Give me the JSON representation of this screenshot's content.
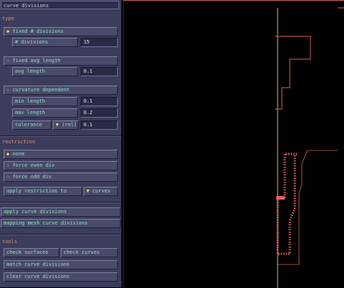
{
  "panel": {
    "title": "curve divisions",
    "type_label": "type",
    "fixed_divisions": "fixed # divisions",
    "num_divisions_label": "# divisions",
    "num_divisions_value": "15",
    "fixed_avg_length": "fixed avg length",
    "avg_length_label": "avg length",
    "avg_length_value": "0.1",
    "curvature_dependent": "curvature dependent",
    "min_length_label": "min length",
    "min_length_value": "0.1",
    "max_length_label": "max length",
    "max_length_value": "0.2",
    "tolerance_label": "tolerance",
    "tolerance_mode": "(rel)",
    "tolerance_value": "0.1",
    "restriction_label": "restriction",
    "none": "none",
    "force_even": "force even div",
    "force_odd": "force odd div",
    "apply_restriction_to": "apply restriction to",
    "apply_restriction_target": "curves",
    "apply_curve_divisions": "apply curve divisions",
    "mapping_mesh": "mapping mesh curve divisions",
    "tools_label": "tools",
    "check_surfaces": "check surfaces",
    "check_curves": "check curves",
    "match_curve_divisions": "match curve divisions",
    "clear_curve_divisions": "clear curve divisions",
    "selected_marker": "◆",
    "unselected_marker": "◇",
    "dropdown_marker": "▼"
  },
  "colors": {
    "panel_bg": "#3c3c5c",
    "button_text": "#8fe0c0",
    "section_label": "#e09070",
    "selected_mark": "#ffe040",
    "curve": "#e06060",
    "guide_line": "#e8c060"
  }
}
